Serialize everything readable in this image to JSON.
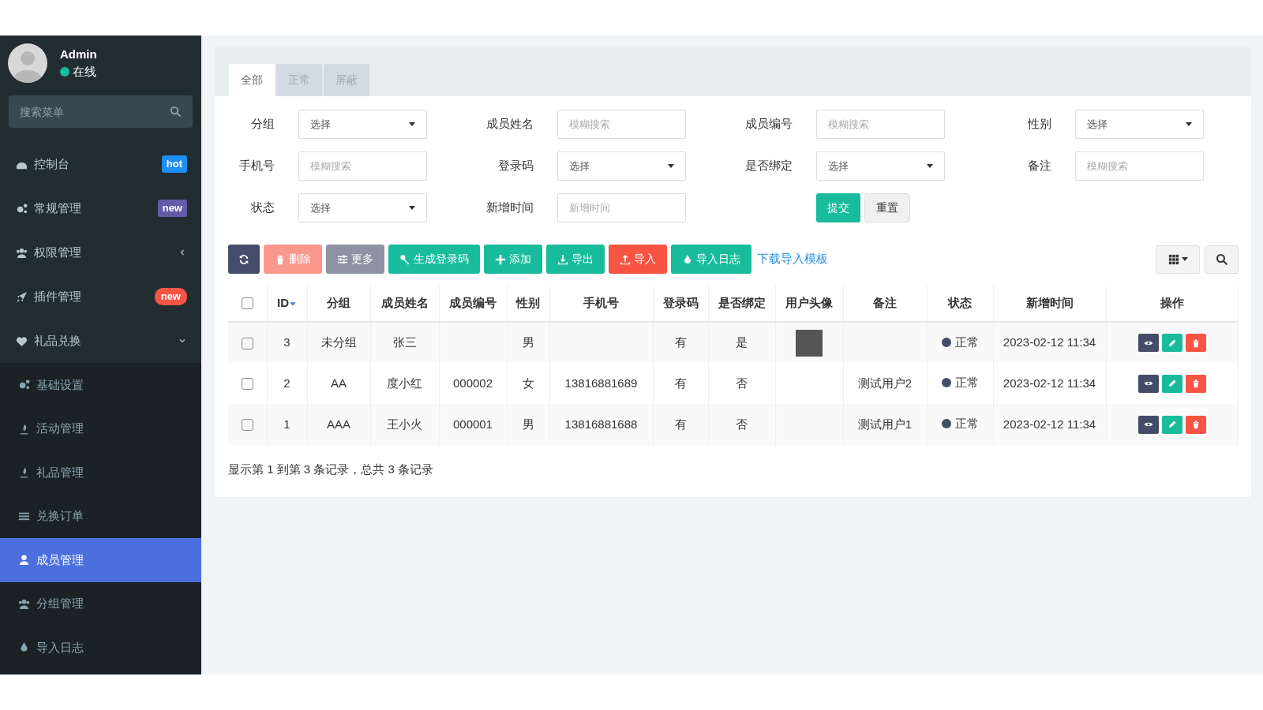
{
  "user": {
    "name": "Admin",
    "status": "在线",
    "color": "#18bc9c"
  },
  "sidebar_search": {
    "placeholder": "搜索菜单"
  },
  "menu": [
    {
      "label": "控制台",
      "badge": {
        "text": "hot",
        "color": "#1e8ff2",
        "kind": "label"
      },
      "selected": false
    },
    {
      "label": "常规管理",
      "badge": {
        "text": "new",
        "color": "#605ca8",
        "kind": "label"
      },
      "selected": false
    },
    {
      "label": "权限管理",
      "has_children": true,
      "expanded": false,
      "selected": false
    },
    {
      "label": "插件管理",
      "badge": {
        "text": "new",
        "color": "#f75444",
        "kind": "pill"
      },
      "selected": false
    },
    {
      "label": "礼品兑换",
      "has_children": true,
      "expanded": true,
      "selected": false,
      "children": [
        {
          "label": "基础设置",
          "selected": false
        },
        {
          "label": "活动管理",
          "selected": false
        },
        {
          "label": "礼品管理",
          "selected": false
        },
        {
          "label": "兑换订单",
          "selected": false
        },
        {
          "label": "成员管理",
          "selected": true
        },
        {
          "label": "分组管理",
          "selected": false
        },
        {
          "label": "导入日志",
          "selected": false
        }
      ]
    }
  ],
  "tabs": [
    {
      "label": "全部",
      "selected": true
    },
    {
      "label": "正常",
      "selected": false
    },
    {
      "label": "屏蔽",
      "selected": false
    }
  ],
  "filters": [
    {
      "label": "分组",
      "kind": "select",
      "value": "选择"
    },
    {
      "label": "成员姓名",
      "kind": "input",
      "placeholder": "模糊搜索"
    },
    {
      "label": "成员编号",
      "kind": "input",
      "placeholder": "模糊搜索"
    },
    {
      "label": "性别",
      "kind": "select",
      "value": "选择"
    },
    {
      "label": "手机号",
      "kind": "input",
      "placeholder": "模糊搜索"
    },
    {
      "label": "登录码",
      "kind": "select",
      "value": "选择"
    },
    {
      "label": "是否绑定",
      "kind": "select",
      "value": "选择"
    },
    {
      "label": "备注",
      "kind": "input",
      "placeholder": "模糊搜索"
    },
    {
      "label": "状态",
      "kind": "select",
      "value": "选择"
    },
    {
      "label": "新增时间",
      "kind": "input",
      "placeholder": "新增时间"
    }
  ],
  "filter_buttons": [
    {
      "label": "提交",
      "kind": "primary"
    },
    {
      "label": "重置",
      "kind": "default"
    }
  ],
  "toolbar": [
    {
      "kind": "refresh",
      "disabled": false
    },
    {
      "label": "删除",
      "kind": "delete",
      "disabled": true
    },
    {
      "label": "更多",
      "kind": "more",
      "disabled": true
    },
    {
      "label": "生成登录码",
      "kind": "key",
      "disabled": false
    },
    {
      "label": "添加",
      "kind": "add",
      "disabled": false
    },
    {
      "label": "导出",
      "kind": "export",
      "disabled": false
    },
    {
      "label": "导入",
      "kind": "import",
      "disabled": false
    },
    {
      "label": "导入日志",
      "kind": "log",
      "disabled": false
    }
  ],
  "template_link": "下载导入模板",
  "table": {
    "columns": [
      {
        "label": "ID",
        "sorted": true
      },
      {
        "label": "分组",
        "sorted": false
      },
      {
        "label": "成员姓名",
        "sorted": false
      },
      {
        "label": "成员编号",
        "sorted": false
      },
      {
        "label": "性别",
        "sorted": false
      },
      {
        "label": "手机号",
        "sorted": false
      },
      {
        "label": "登录码",
        "sorted": false
      },
      {
        "label": "是否绑定",
        "sorted": false
      },
      {
        "label": "用户头像",
        "sorted": false
      },
      {
        "label": "备注",
        "sorted": false
      },
      {
        "label": "状态",
        "sorted": false
      },
      {
        "label": "新增时间",
        "sorted": false
      },
      {
        "label": "操作",
        "sorted": false
      }
    ],
    "all_checked": false,
    "rows": [
      {
        "checked": false,
        "id": "3",
        "group": "未分组",
        "name": "张三",
        "code": "",
        "gender": "男",
        "phone": "",
        "login_code": "有",
        "bound": "是",
        "has_avatar": true,
        "remark": "",
        "status": "正常",
        "color": "#444c69",
        "created": "2023-02-12 11:34"
      },
      {
        "checked": false,
        "id": "2",
        "group": "AA",
        "name": "度小红",
        "code": "000002",
        "gender": "女",
        "phone": "13816881689",
        "login_code": "有",
        "bound": "否",
        "has_avatar": false,
        "remark": "测试用户2",
        "status": "正常",
        "color": "#444c69",
        "created": "2023-02-12 11:34"
      },
      {
        "checked": false,
        "id": "1",
        "group": "AAA",
        "name": "王小火",
        "code": "000001",
        "gender": "男",
        "phone": "13816881688",
        "login_code": "有",
        "bound": "否",
        "has_avatar": false,
        "remark": "测试用户1",
        "status": "正常",
        "color": "#444c69",
        "created": "2023-02-12 11:34"
      }
    ]
  },
  "pagination_info": "显示第 1 到第 3 条记录，总共 3 条记录"
}
